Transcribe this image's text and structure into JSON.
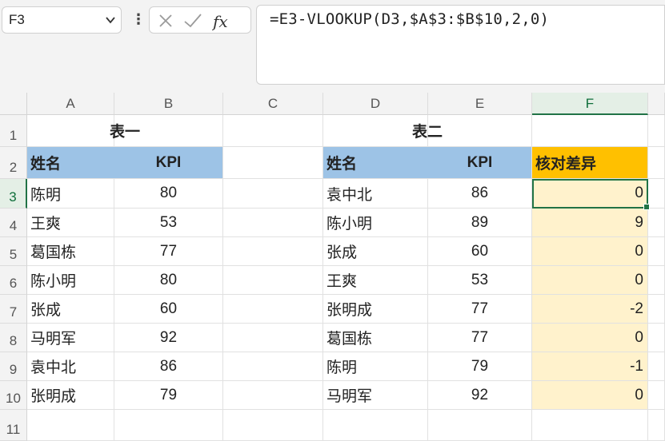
{
  "name_box": "F3",
  "formula": "=E3-VLOOKUP(D3,$A$3:$B$10,2,0)",
  "colors": {
    "header_blue": "#9dc3e6",
    "header_orange": "#ffc000",
    "diff_fill": "#fff2cc",
    "select_green": "#217346"
  },
  "icons": {
    "cancel": "x-icon",
    "confirm": "check-icon",
    "function": "fx-icon"
  },
  "columns": [
    "A",
    "B",
    "C",
    "D",
    "E",
    "F"
  ],
  "rows": [
    "1",
    "2",
    "3",
    "4",
    "5",
    "6",
    "7",
    "8",
    "9",
    "10",
    "11"
  ],
  "table1": {
    "title": "表一",
    "headers": [
      "姓名",
      "KPI"
    ],
    "rows": [
      [
        "陈明",
        "80"
      ],
      [
        "王爽",
        "53"
      ],
      [
        "葛国栋",
        "77"
      ],
      [
        "陈小明",
        "80"
      ],
      [
        "张成",
        "60"
      ],
      [
        "马明军",
        "92"
      ],
      [
        "袁中北",
        "86"
      ],
      [
        "张明成",
        "79"
      ]
    ]
  },
  "table2": {
    "title": "表二",
    "headers": [
      "姓名",
      "KPI",
      "核对差异"
    ],
    "rows": [
      [
        "袁中北",
        "86",
        "0"
      ],
      [
        "陈小明",
        "89",
        "9"
      ],
      [
        "张成",
        "60",
        "0"
      ],
      [
        "王爽",
        "53",
        "0"
      ],
      [
        "张明成",
        "77",
        "-2"
      ],
      [
        "葛国栋",
        "77",
        "0"
      ],
      [
        "陈明",
        "79",
        "-1"
      ],
      [
        "马明军",
        "92",
        "0"
      ]
    ]
  }
}
